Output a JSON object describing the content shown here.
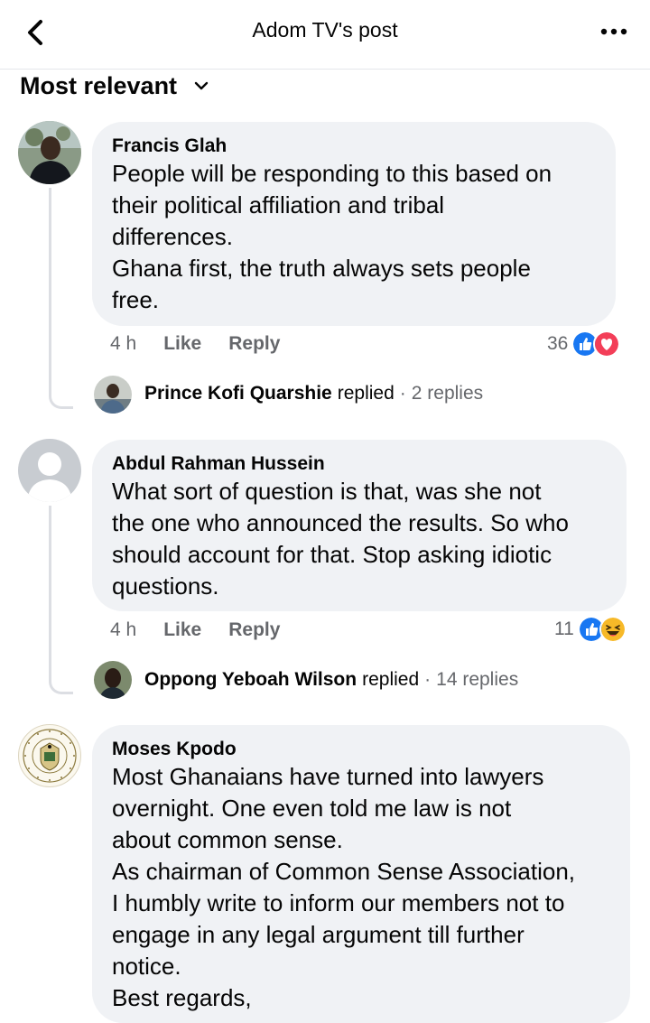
{
  "header": {
    "title": "Adom TV's post",
    "back_icon": "chevron-left-icon",
    "more_icon": "more-horizontal-icon"
  },
  "sort": {
    "label": "Most relevant",
    "icon": "chevron-down-icon"
  },
  "comments": [
    {
      "author": "Francis Glah",
      "text": "People will be  responding to this based on\ntheir political affiliation and tribal\ndifferences.\nGhana first, the truth always sets people\nfree.",
      "time": "4 h",
      "like_label": "Like",
      "reply_label": "Reply",
      "reaction_count": "36",
      "reactions": [
        "like-reaction-icon",
        "love-reaction-icon"
      ],
      "reply_preview": {
        "name": "Prince Kofi Quarshie",
        "verb": "replied",
        "dot": "·",
        "count": "2 replies"
      }
    },
    {
      "author": "Abdul Rahman Hussein",
      "text": "What sort of question is that, was she not\nthe one who announced the results. So who\nshould account for that. Stop asking idiotic\nquestions.",
      "time": "4 h",
      "like_label": "Like",
      "reply_label": "Reply",
      "reaction_count": "11",
      "reactions": [
        "like-reaction-icon",
        "haha-reaction-icon"
      ],
      "reply_preview": {
        "name": "Oppong Yeboah Wilson",
        "verb": "replied",
        "dot": "·",
        "count": "14 replies"
      }
    },
    {
      "author": "Moses Kpodo",
      "text": "Most Ghanaians have turned into lawyers\novernight. One even told me law is not\nabout common sense.\nAs chairman of Common Sense Association,\nI humbly write to inform our members not to\nengage in any legal argument till further\nnotice.\nBest regards,",
      "avatar_seal_text": "THE PRESIDENCY · REPUBLIC OF GHANA"
    }
  ],
  "colors": {
    "like_blue": "#1877f2",
    "love_red": "#f33e58",
    "haha_yellow": "#f7b928",
    "bubble": "#f0f2f5",
    "meta_gray": "#65676b"
  }
}
